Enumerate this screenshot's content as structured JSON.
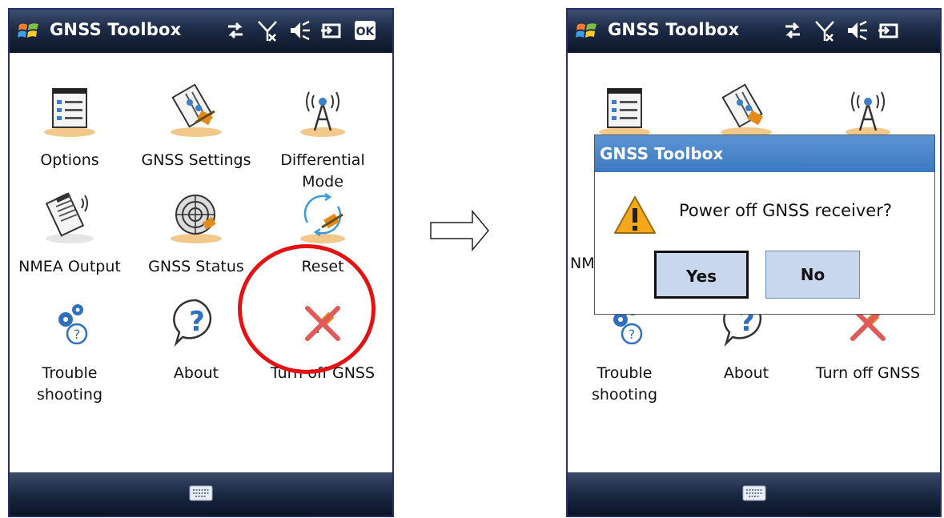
{
  "window": {
    "title": "GNSS Toolbox",
    "ok_label": "OK"
  },
  "left_screen": {
    "apps": [
      {
        "label": "Options",
        "icon": "options-list-icon"
      },
      {
        "label": "GNSS Settings",
        "icon": "gnss-settings-icon"
      },
      {
        "label": "Differential\nMode",
        "icon": "antenna-tower-icon"
      },
      {
        "label": "NMEA Output",
        "icon": "nmea-output-icon"
      },
      {
        "label": "GNSS Status",
        "icon": "gnss-status-radar-icon"
      },
      {
        "label": "Reset",
        "icon": "reset-cycle-icon"
      },
      {
        "label": "Trouble\nshooting",
        "icon": "troubleshooting-gears-icon"
      },
      {
        "label": "About",
        "icon": "about-question-icon"
      },
      {
        "label": "Turn off GNSS",
        "icon": "turn-off-gnss-icon"
      }
    ]
  },
  "right_screen": {
    "partial_label": "NM",
    "apps": [
      {
        "label": "Trouble\nshooting"
      },
      {
        "label": "About"
      },
      {
        "label": "Turn off GNSS"
      }
    ],
    "dialog": {
      "title": "GNSS Toolbox",
      "message": "Power off GNSS receiver?",
      "yes_label": "Yes",
      "no_label": "No"
    }
  },
  "colors": {
    "highlight": "#e41212",
    "titlebar": "#1d2b47",
    "dialog_title": "#4a86cb",
    "button_face": "#c8d6ee"
  }
}
